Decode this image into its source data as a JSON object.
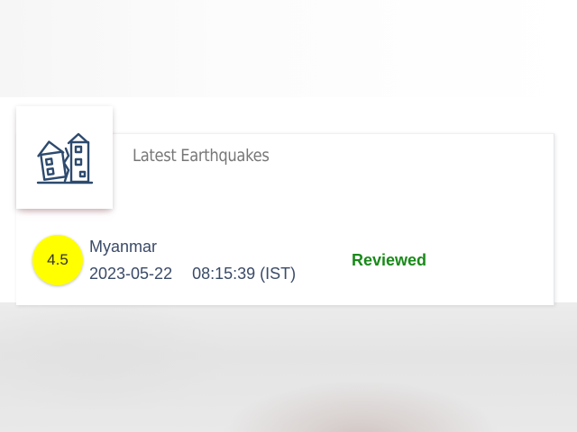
{
  "card": {
    "title": "Latest Earthquakes",
    "icon": "earthquake-houses-icon"
  },
  "event": {
    "magnitude": "4.5",
    "location": "Myanmar",
    "date": "2023-05-22",
    "time": "08:15:39 (IST)",
    "status": "Reviewed"
  },
  "colors": {
    "magnitude_badge": "#ffff00",
    "status": "#188a18",
    "text": "#3a4a68",
    "icon": "#2d4a6e"
  }
}
